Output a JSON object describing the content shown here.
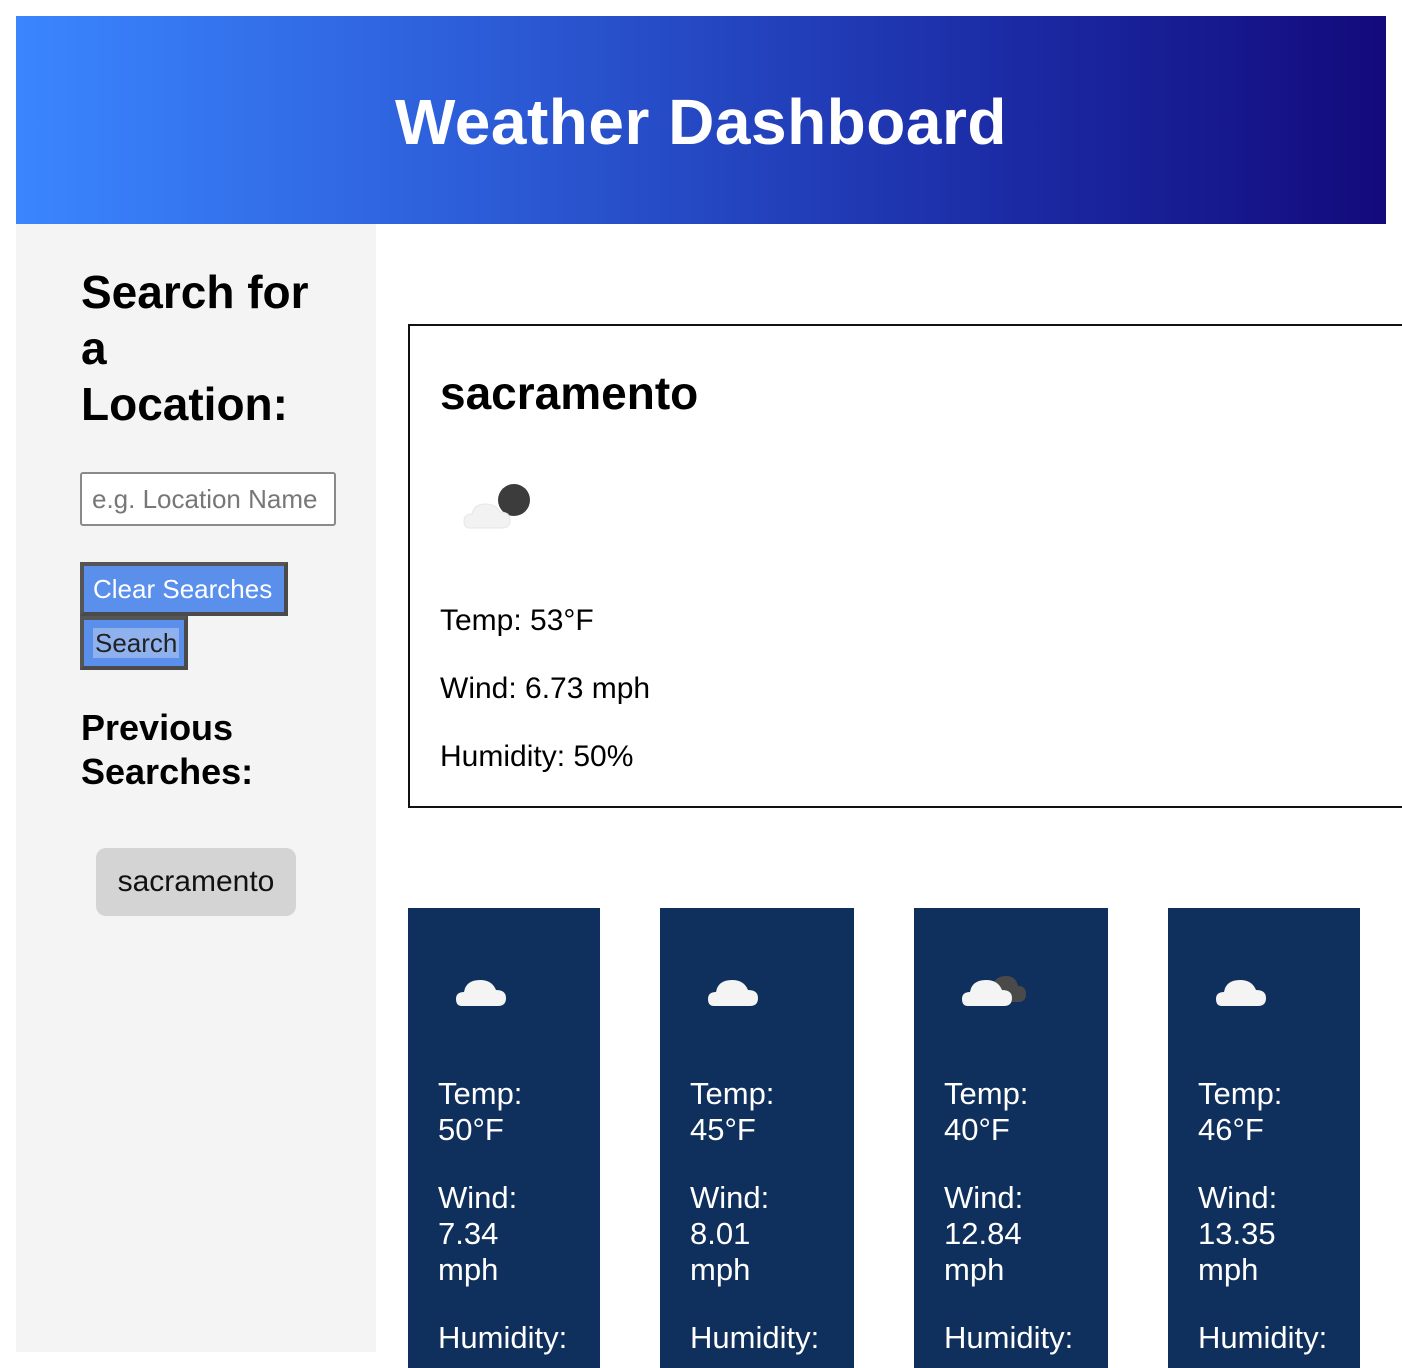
{
  "header": {
    "title": "Weather Dashboard"
  },
  "sidebar": {
    "search_title": "Search for a Location:",
    "search_placeholder": "e.g. Location Name",
    "search_value": "",
    "clear_label": "Clear Searches",
    "search_label": "Search",
    "previous_title": "Previous Searches:",
    "previous": [
      "sacramento"
    ]
  },
  "current": {
    "city": "sacramento",
    "icon": "cloud-night-icon",
    "temp": "Temp: 53°F",
    "wind": "Wind: 6.73 mph",
    "humidity": "Humidity: 50%"
  },
  "forecast": [
    {
      "icon": "cloud-icon",
      "temp_label": "Temp:",
      "temp": "50°F",
      "wind_label": "Wind:",
      "wind_value": "7.34",
      "wind_unit": "mph",
      "humidity_label": "Humidity:"
    },
    {
      "icon": "cloud-icon",
      "temp_label": "Temp:",
      "temp": "45°F",
      "wind_label": "Wind:",
      "wind_value": "8.01",
      "wind_unit": "mph",
      "humidity_label": "Humidity:"
    },
    {
      "icon": "cloud-dark-icon",
      "temp_label": "Temp:",
      "temp": "40°F",
      "wind_label": "Wind:",
      "wind_value": "12.84",
      "wind_unit": "mph",
      "humidity_label": "Humidity:"
    },
    {
      "icon": "cloud-icon",
      "temp_label": "Temp:",
      "temp": "46°F",
      "wind_label": "Wind:",
      "wind_value": "13.35",
      "wind_unit": "mph",
      "humidity_label": "Humidity:"
    }
  ],
  "colors": {
    "header_start": "#3a86ff",
    "header_end": "#130a7c",
    "sidebar_bg": "#f4f4f4",
    "button_bg": "#5a8fec",
    "card_bg": "#0f2f5c"
  }
}
